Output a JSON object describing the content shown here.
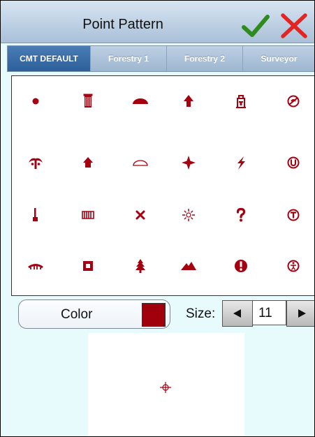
{
  "title": "Point Pattern",
  "actions": {
    "confirm_icon": "checkmark-icon",
    "cancel_icon": "close-icon"
  },
  "tabs": [
    {
      "label": "CMT DEFAULT",
      "active": true
    },
    {
      "label": "Forestry 1",
      "active": false
    },
    {
      "label": "Forestry 2",
      "active": false
    },
    {
      "label": "Surveyor",
      "active": false
    }
  ],
  "symbol_color": "#a50010",
  "symbols": [
    [
      "dot",
      "trash-can",
      "dome",
      "arrow-up",
      "hydrant",
      "no-entry-gauge"
    ],
    [
      "palm-tree",
      "house-arrow",
      "dome-outline",
      "four-point-star",
      "lightning-bolt",
      "circled-u"
    ],
    [
      "candle-post",
      "fence",
      "x-mark",
      "sunburst",
      "question-mark",
      "circled-t"
    ],
    [
      "bridge",
      "framed-square",
      "pine-tree",
      "mountain",
      "exclamation-circle",
      "circled-figure"
    ]
  ],
  "color_control": {
    "label": "Color",
    "value": "#a0000b"
  },
  "size_control": {
    "label": "Size:",
    "value": "11",
    "decrease_icon": "left-triangle-icon",
    "increase_icon": "right-triangle-icon"
  },
  "preview": {
    "marker_icon": "crosshair-icon"
  }
}
